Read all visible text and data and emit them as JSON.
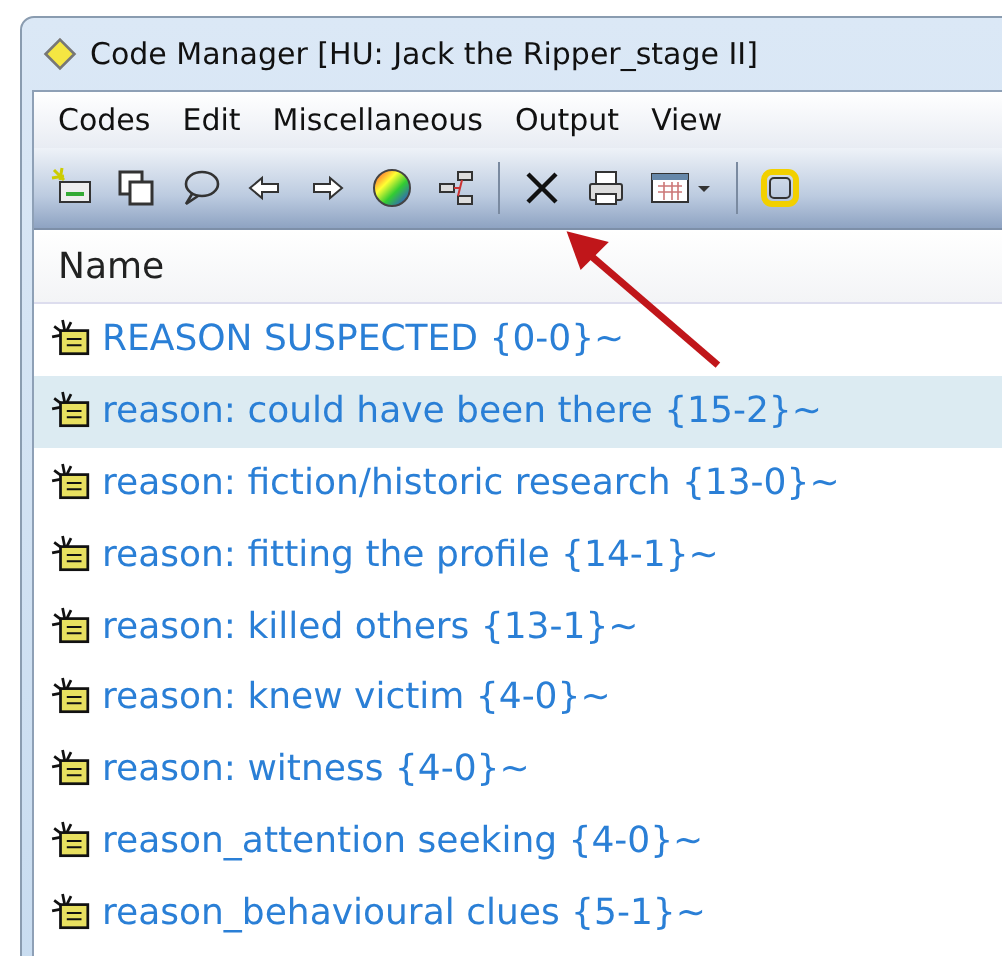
{
  "window": {
    "title": "Code Manager [HU: Jack the Ripper_stage II]"
  },
  "menu": [
    "Codes",
    "Edit",
    "Miscellaneous",
    "Output",
    "View"
  ],
  "list": {
    "column": "Name",
    "rows": [
      {
        "label": "REASON SUSPECTED {0-0}~",
        "selected": false
      },
      {
        "label": "reason: could have been there {15-2}~",
        "selected": true
      },
      {
        "label": "reason: fiction/historic research {13-0}~",
        "selected": false
      },
      {
        "label": "reason: fitting the profile {14-1}~",
        "selected": false
      },
      {
        "label": "reason: killed others {13-1}~",
        "selected": false
      },
      {
        "label": "reason: knew victim {4-0}~",
        "selected": false
      },
      {
        "label": "reason: witness {4-0}~",
        "selected": false
      },
      {
        "label": "reason_attention seeking {4-0}~",
        "selected": false
      },
      {
        "label": "reason_behavioural clues {5-1}~",
        "selected": false
      }
    ]
  }
}
